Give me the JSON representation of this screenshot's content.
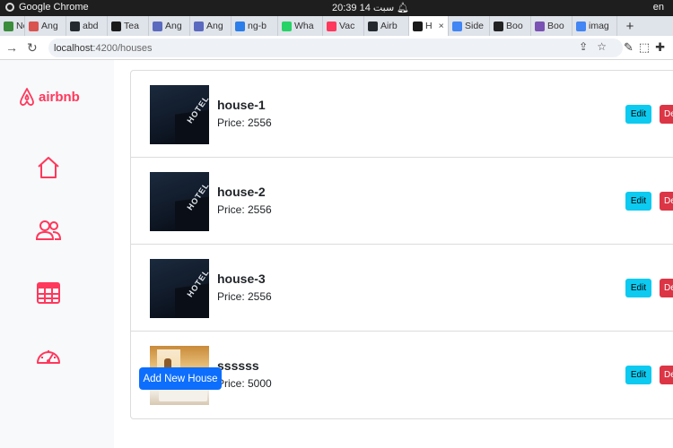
{
  "os": {
    "app_name": "Google Chrome",
    "clock": "20:39  14 سبت",
    "lang": "en"
  },
  "tabs": [
    {
      "label": "Nod",
      "color": "#3b8c3b"
    },
    {
      "label": "Ang",
      "color": "#d9534f"
    },
    {
      "label": "abd",
      "color": "#24292f"
    },
    {
      "label": "Tea",
      "color": "#1a1a1a"
    },
    {
      "label": "Ang",
      "color": "#5b6abf"
    },
    {
      "label": "Ang",
      "color": "#5b6abf"
    },
    {
      "label": "ng-b",
      "color": "#2b7de9"
    },
    {
      "label": "Wha",
      "color": "#25d366"
    },
    {
      "label": "Vac",
      "color": "#ff385c"
    },
    {
      "label": "Airb",
      "color": "#24292f"
    },
    {
      "label": "H",
      "color": "#1a1a1a",
      "active": true
    },
    {
      "label": "Side",
      "color": "#4285f4"
    },
    {
      "label": "Boo",
      "color": "#222222"
    },
    {
      "label": "Boo",
      "color": "#7952b3"
    },
    {
      "label": "imag",
      "color": "#4285f4"
    }
  ],
  "address": {
    "host": "localhost",
    "path": ":4200/houses"
  },
  "sidebar": {
    "logo_text": "airbnb",
    "icons": [
      "home-icon",
      "users-icon",
      "table-icon",
      "dashboard-icon"
    ]
  },
  "houses": [
    {
      "name": "house-1",
      "price_label": "Price: 2556",
      "image": "hotel"
    },
    {
      "name": "house-2",
      "price_label": "Price: 2556",
      "image": "hotel"
    },
    {
      "name": "house-3",
      "price_label": "Price: 2556",
      "image": "hotel"
    },
    {
      "name": "ssssss",
      "price_label": "Price: 5000",
      "image": "bedroom"
    }
  ],
  "buttons": {
    "edit": "Edit",
    "delete": "De",
    "add": "Add New House"
  },
  "thumb_sign": "HOTEL",
  "colors": {
    "accent": "#ff385c",
    "edit": "#0dcaf0",
    "delete": "#dc3545",
    "primary": "#0d6efd"
  }
}
